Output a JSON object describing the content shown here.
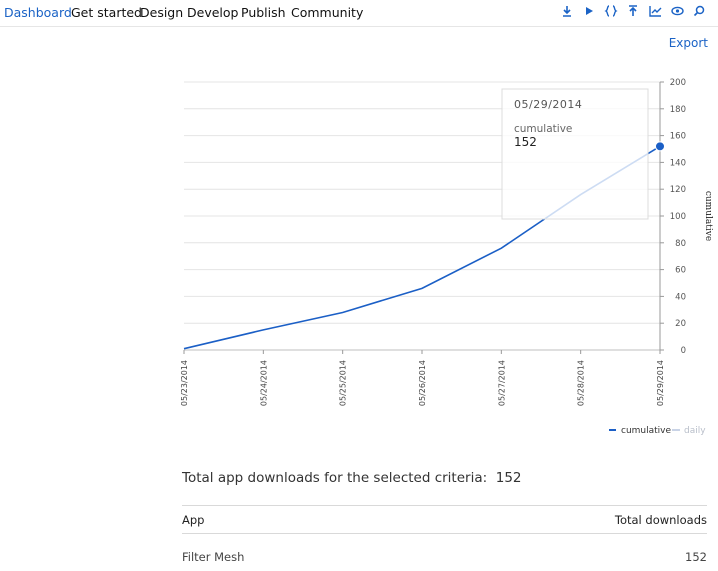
{
  "nav": {
    "items": [
      "Dashboard",
      "Get started",
      "Design",
      "Develop",
      "Publish",
      "Community"
    ],
    "active": "Dashboard"
  },
  "toolbar": {
    "icons": [
      "download-icon",
      "play-icon",
      "braces-icon",
      "upload-icon",
      "line-chart-icon",
      "eye-icon",
      "search-icon"
    ]
  },
  "export_label": "Export",
  "chart_data": {
    "type": "line",
    "x": [
      "05/23/2014",
      "05/24/2014",
      "05/25/2014",
      "05/26/2014",
      "05/27/2014",
      "05/28/2014",
      "05/29/2014"
    ],
    "series": [
      {
        "name": "cumulative",
        "values": [
          1,
          15,
          28,
          46,
          76,
          116,
          152
        ],
        "color": "#1b5fc6"
      }
    ],
    "legend": [
      "cumulative",
      "daily"
    ],
    "legend_placement": "bottom-right",
    "ylabel": "cumulative",
    "ylim": [
      0,
      200
    ],
    "yticks": [
      0,
      20,
      40,
      60,
      80,
      100,
      120,
      140,
      160,
      180,
      200
    ],
    "y_axis_side": "right",
    "grid": true,
    "tooltip": {
      "date": "05/29/2014",
      "label": "cumulative",
      "value": "152"
    }
  },
  "summary": {
    "label": "Total app downloads for the selected criteria:",
    "value": "152"
  },
  "table": {
    "headers": [
      "App",
      "Total downloads"
    ],
    "rows": [
      {
        "app": "Filter Mesh",
        "total": "152"
      }
    ]
  }
}
